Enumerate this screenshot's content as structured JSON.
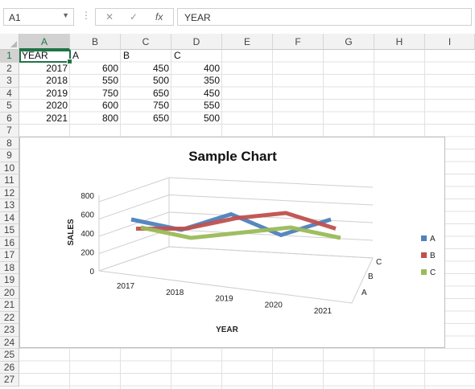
{
  "formula_bar": {
    "name_box": "A1",
    "formula_value": "YEAR",
    "cancel_icon": "cancel-icon",
    "enter_icon": "check-icon",
    "fx_label": "fx"
  },
  "columns": [
    "A",
    "B",
    "C",
    "D",
    "E",
    "F",
    "G",
    "H",
    "I"
  ],
  "rows": [
    "1",
    "2",
    "3",
    "4",
    "5",
    "6",
    "7",
    "8",
    "9",
    "10",
    "11",
    "12",
    "13",
    "14",
    "15",
    "16",
    "17",
    "18",
    "19",
    "20",
    "21",
    "22",
    "23",
    "24",
    "25",
    "26",
    "27"
  ],
  "table": {
    "header": [
      "YEAR",
      "A",
      "B",
      "C"
    ],
    "rows": [
      [
        "2017",
        "600",
        "450",
        "400"
      ],
      [
        "2018",
        "550",
        "500",
        "350"
      ],
      [
        "2019",
        "750",
        "650",
        "450"
      ],
      [
        "2020",
        "600",
        "750",
        "550"
      ],
      [
        "2021",
        "800",
        "650",
        "500"
      ]
    ]
  },
  "chart_data": {
    "type": "line",
    "title": "Sample Chart",
    "xlabel": "YEAR",
    "ylabel": "SALES",
    "categories": [
      "2017",
      "2018",
      "2019",
      "2020",
      "2021"
    ],
    "series": [
      {
        "name": "A",
        "values": [
          600,
          550,
          750,
          600,
          800
        ],
        "color": "#4f81bd"
      },
      {
        "name": "B",
        "values": [
          450,
          500,
          650,
          750,
          650
        ],
        "color": "#c0504d"
      },
      {
        "name": "C",
        "values": [
          400,
          350,
          450,
          550,
          500
        ],
        "color": "#9bbb59"
      }
    ],
    "yticks": [
      "0",
      "200",
      "400",
      "600",
      "800"
    ],
    "ylim": [
      0,
      800
    ],
    "legend": "right",
    "depth_labels": [
      "C",
      "B",
      "A"
    ],
    "style": "3d-line"
  }
}
